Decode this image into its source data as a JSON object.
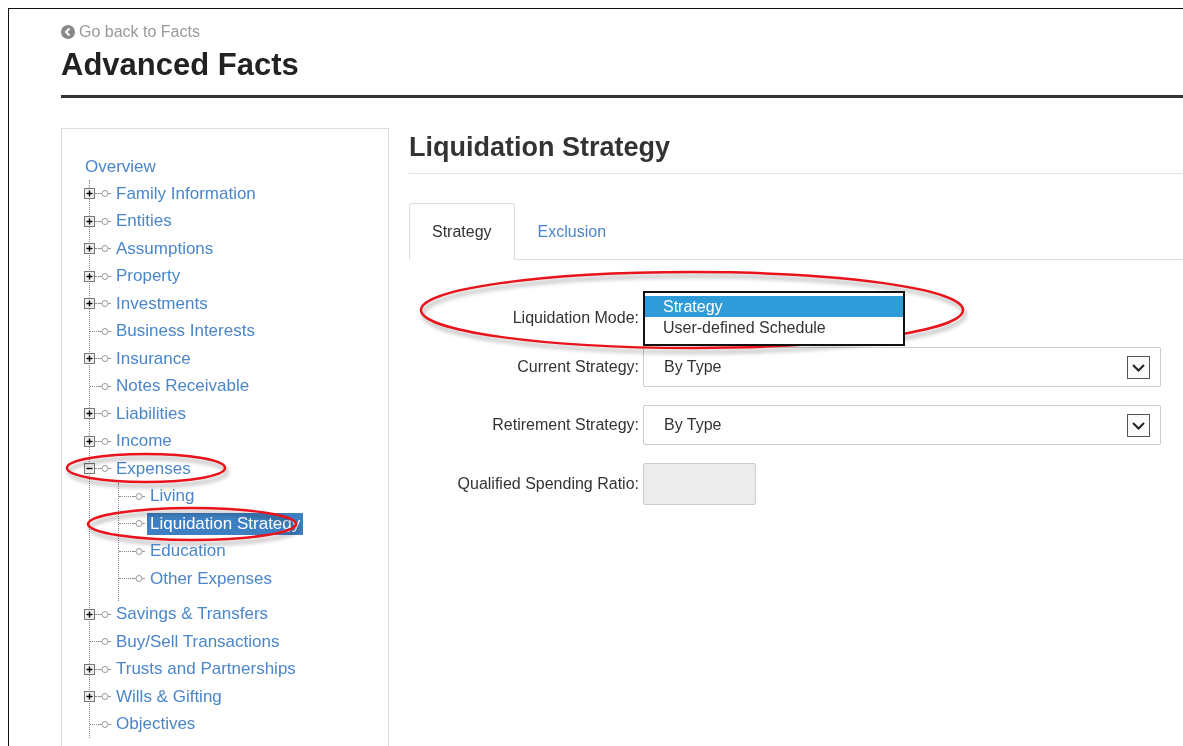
{
  "back_link": "Go back to Facts",
  "title": "Advanced Facts",
  "nav": {
    "overview": "Overview",
    "items": [
      {
        "label": "Family Information",
        "expanded": false,
        "selected": false
      },
      {
        "label": "Entities",
        "expanded": false,
        "selected": false
      },
      {
        "label": "Assumptions",
        "expanded": false,
        "selected": false
      },
      {
        "label": "Property",
        "expanded": false,
        "selected": false
      },
      {
        "label": "Investments",
        "expanded": false,
        "selected": false
      },
      {
        "label": "Business Interests",
        "selected": false
      },
      {
        "label": "Insurance",
        "expanded": false,
        "selected": false
      },
      {
        "label": "Notes Receivable",
        "selected": false
      },
      {
        "label": "Liabilities",
        "expanded": false,
        "selected": false
      },
      {
        "label": "Income",
        "expanded": false,
        "selected": false
      },
      {
        "label": "Expenses",
        "expanded": true,
        "selected": false,
        "circled": true,
        "children": [
          {
            "label": "Living",
            "selected": false
          },
          {
            "label": "Liquidation Strategy",
            "selected": true,
            "circled": true
          },
          {
            "label": "Education",
            "selected": false
          },
          {
            "label": "Other Expenses",
            "selected": false
          }
        ]
      },
      {
        "label": "Savings & Transfers",
        "expanded": false,
        "selected": false
      },
      {
        "label": "Buy/Sell Transactions",
        "selected": false
      },
      {
        "label": "Trusts and Partnerships",
        "expanded": false,
        "selected": false
      },
      {
        "label": "Wills & Gifting",
        "expanded": false,
        "selected": false
      },
      {
        "label": "Objectives",
        "selected": false
      }
    ]
  },
  "panel": {
    "title": "Liquidation Strategy",
    "tabs": [
      {
        "label": "Strategy",
        "selected": true
      },
      {
        "label": "Exclusion",
        "selected": false
      }
    ],
    "fields": [
      {
        "kind": "listbox",
        "label": "Liquidation Mode:",
        "circled": true,
        "options": [
          {
            "label": "Strategy",
            "selected": true
          },
          {
            "label": "User-defined Schedule",
            "selected": false
          }
        ]
      },
      {
        "kind": "select",
        "label": "Current Strategy:",
        "value": "By Type"
      },
      {
        "kind": "select",
        "label": "Retirement Strategy:",
        "value": "By Type"
      },
      {
        "kind": "input",
        "label": "Qualified Spending Ratio:",
        "disabled": true
      }
    ]
  }
}
